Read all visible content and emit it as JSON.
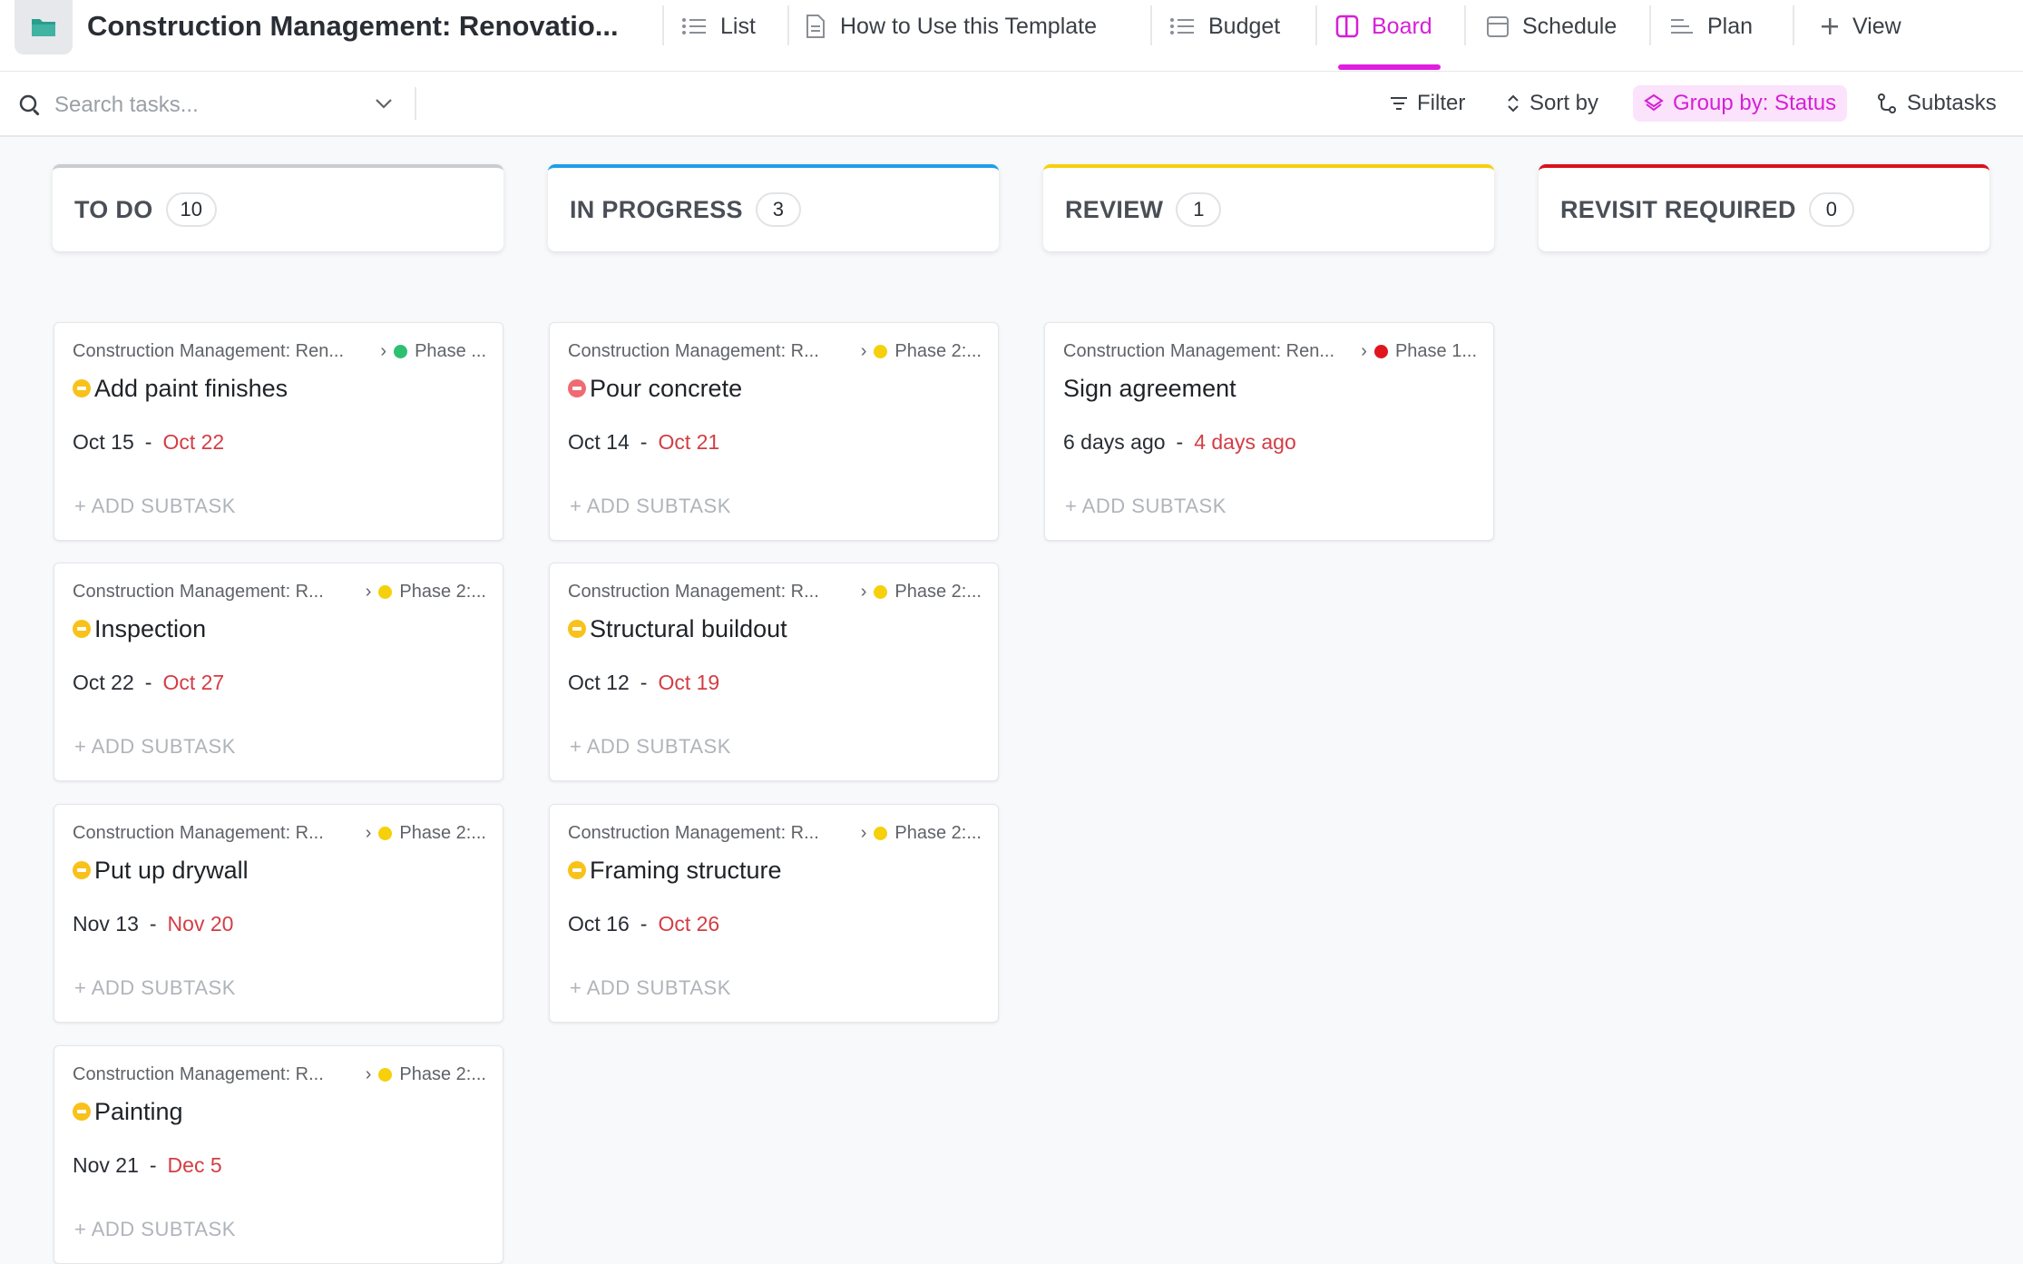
{
  "header": {
    "title": "Construction Management: Renovatio...",
    "tabs": [
      {
        "label": "List"
      },
      {
        "label": "How to Use this Template"
      },
      {
        "label": "Budget"
      },
      {
        "label": "Board"
      },
      {
        "label": "Schedule"
      },
      {
        "label": "Plan"
      },
      {
        "label": "View"
      }
    ],
    "active_tab": "Board",
    "accent": "#d61fd6"
  },
  "toolbar": {
    "search_placeholder": "Search tasks...",
    "filter": "Filter",
    "sort": "Sort by",
    "group": "Group by: Status",
    "subtasks": "Subtasks"
  },
  "columns": [
    {
      "name": "TO DO",
      "count": "10",
      "color": "#c9ccd1",
      "cards": [
        {
          "list": "Construction Management: Ren...",
          "phase": "Phase ...",
          "phase_color": "#2fbf71",
          "status_color": "#f8c21b",
          "title": "Add paint finishes",
          "start": "Oct 15",
          "sep": "-",
          "due": "Oct 22",
          "add": "+ ADD SUBTASK"
        },
        {
          "list": "Construction Management: R...",
          "phase": "Phase 2:...",
          "phase_color": "#f5d00b",
          "status_color": "#f8c21b",
          "title": "Inspection",
          "start": "Oct 22",
          "sep": "-",
          "due": "Oct 27",
          "add": "+ ADD SUBTASK"
        },
        {
          "list": "Construction Management: R...",
          "phase": "Phase 2:...",
          "phase_color": "#f5d00b",
          "status_color": "#f8c21b",
          "title": "Put up drywall",
          "start": "Nov 13",
          "sep": "-",
          "due": "Nov 20",
          "add": "+ ADD SUBTASK"
        },
        {
          "list": "Construction Management: R...",
          "phase": "Phase 2:...",
          "phase_color": "#f5d00b",
          "status_color": "#f8c21b",
          "title": "Painting",
          "start": "Nov 21",
          "sep": "-",
          "due": "Dec 5",
          "add": "+ ADD SUBTASK"
        }
      ]
    },
    {
      "name": "IN PROGRESS",
      "count": "3",
      "color": "#1e9fe8",
      "cards": [
        {
          "list": "Construction Management: R...",
          "phase": "Phase 2:...",
          "phase_color": "#f5d00b",
          "status_color": "#ef6b73",
          "title": "Pour concrete",
          "start": "Oct 14",
          "sep": "-",
          "due": "Oct 21",
          "add": "+ ADD SUBTASK"
        },
        {
          "list": "Construction Management: R...",
          "phase": "Phase 2:...",
          "phase_color": "#f5d00b",
          "status_color": "#f8c21b",
          "title": "Structural buildout",
          "start": "Oct 12",
          "sep": "-",
          "due": "Oct 19",
          "add": "+ ADD SUBTASK"
        },
        {
          "list": "Construction Management: R...",
          "phase": "Phase 2:...",
          "phase_color": "#f5d00b",
          "status_color": "#f8c21b",
          "title": "Framing structure",
          "start": "Oct 16",
          "sep": "-",
          "due": "Oct 26",
          "add": "+ ADD SUBTASK"
        }
      ]
    },
    {
      "name": "REVIEW",
      "count": "1",
      "color": "#f5d00b",
      "cards": [
        {
          "list": "Construction Management: Ren...",
          "phase": "Phase 1...",
          "phase_color": "#e0161e",
          "status_color": "",
          "title": "Sign agreement",
          "start": "6 days ago",
          "sep": "-",
          "due": "4 days ago",
          "add": "+ ADD SUBTASK"
        }
      ]
    },
    {
      "name": "REVISIT REQUIRED",
      "count": "0",
      "color": "#d8131b",
      "cards": []
    }
  ]
}
